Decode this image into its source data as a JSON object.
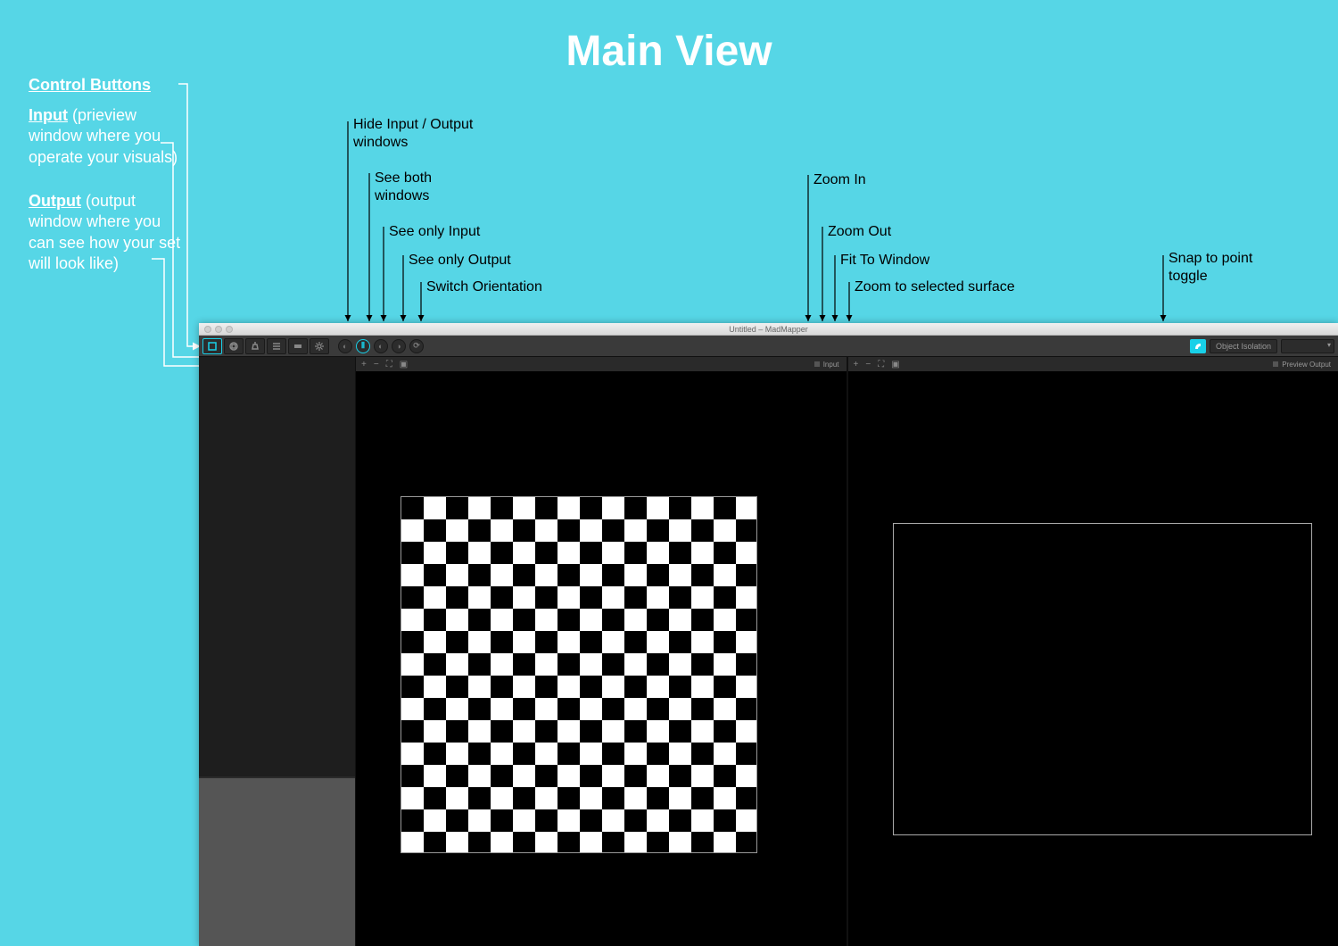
{
  "page_title": "Main View",
  "labels": {
    "control_buttons": "Control Buttons",
    "input_label": "Input",
    "input_desc": " (prieview window where you operate your visuals)",
    "output_label": "Output",
    "output_desc": " (output window where you can see how your set will look like)"
  },
  "callouts": {
    "hide_io": "Hide Input / Output windows",
    "see_both": "See both windows",
    "see_input": "See only Input",
    "see_output": "See only Output",
    "switch_orient": "Switch Orientation",
    "zoom_in": "Zoom In",
    "zoom_out": "Zoom Out",
    "fit_window": "Fit To Window",
    "zoom_selected": "Zoom to selected surface",
    "snap": "Snap to point toggle"
  },
  "app": {
    "title": "Untitled – MadMapper",
    "object_isolation": "Object Isolation",
    "panes": {
      "input_label": "Input",
      "output_label": "Preview Output"
    },
    "zoom_glyphs": {
      "plus": "+",
      "minus": "−",
      "fit": "⛶",
      "sel": "▣"
    }
  }
}
